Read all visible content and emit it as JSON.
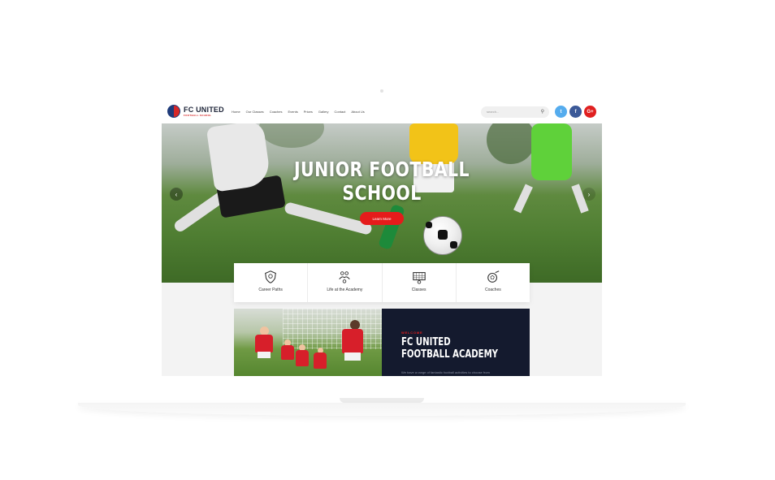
{
  "site": {
    "logo_name": "FC UNITED",
    "logo_sub": "FOOTBALL SCHOOL"
  },
  "nav": [
    "Home",
    "Our Classes",
    "Coaches",
    "Events",
    "Prices",
    "Gallery",
    "Contact",
    "About Us"
  ],
  "search": {
    "placeholder": "search..."
  },
  "social": {
    "twitter": "t",
    "facebook": "f",
    "google": "G+"
  },
  "hero": {
    "title_line1": "JUNIOR FOOTBALL",
    "title_line2": "SCHOOL",
    "button": "Learn More",
    "prev": "‹",
    "next": "›"
  },
  "features": [
    {
      "label": "Career Paths",
      "icon": "shield-icon"
    },
    {
      "label": "Life at the Academy",
      "icon": "players-icon"
    },
    {
      "label": "Classes",
      "icon": "goal-icon"
    },
    {
      "label": "Coaches",
      "icon": "ball-icon"
    }
  ],
  "welcome": {
    "kicker": "WELCOME",
    "title_line1": "FC UNITED",
    "title_line2": "FOOTBALL ACADEMY",
    "text": "We have a range of fantastic football activities to choose from"
  }
}
